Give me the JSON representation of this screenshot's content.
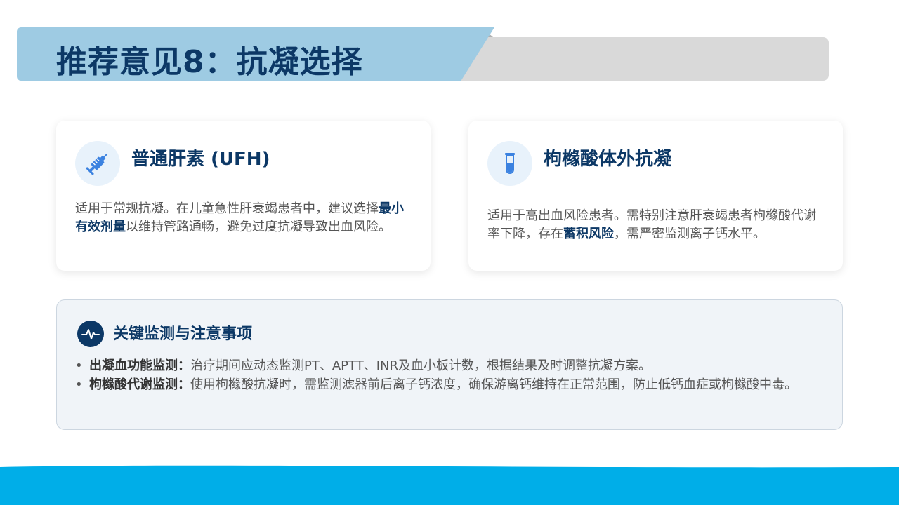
{
  "header": {
    "title": "推荐意见8：抗凝选择"
  },
  "cards": [
    {
      "icon": "syringe-icon",
      "title": "普通肝素 (UFH)",
      "body_before": "适用于常规抗凝。在儿童急性肝衰竭患者中，建议选择",
      "body_highlight": "最小有效剂量",
      "body_after": "以维持管路通畅，避免过度抗凝导致出血风险。"
    },
    {
      "icon": "test-tube-icon",
      "title": "枸橼酸体外抗凝",
      "body_before": "适用于高出血风险患者。需特别注意肝衰竭患者枸橼酸代谢率下降，存在",
      "body_highlight": "蓄积风险",
      "body_after": "，需严密监测离子钙水平。"
    }
  ],
  "monitoring": {
    "icon": "heartbeat-icon",
    "title": "关键监测与注意事项",
    "items": [
      {
        "label": "出凝血功能监测：",
        "text": "治疗期间应动态监测PT、APTT、INR及血小板计数，根据结果及时调整抗凝方案。"
      },
      {
        "label": "枸橼酸代谢监测：",
        "text": "使用枸橼酸抗凝时，需监测滤器前后离子钙浓度，确保游离钙维持在正常范围，防止低钙血症或枸橼酸中毒。"
      }
    ],
    "bullet": "•"
  },
  "colors": {
    "primary": "#0c3866",
    "banner_blue": "#9ecbe3",
    "banner_gray": "#d9d9d9",
    "icon_blue": "#3b82e0",
    "icon_bg": "#e8f2fb",
    "panel_bg": "#f0f4f8",
    "wave": "#00aee8"
  }
}
